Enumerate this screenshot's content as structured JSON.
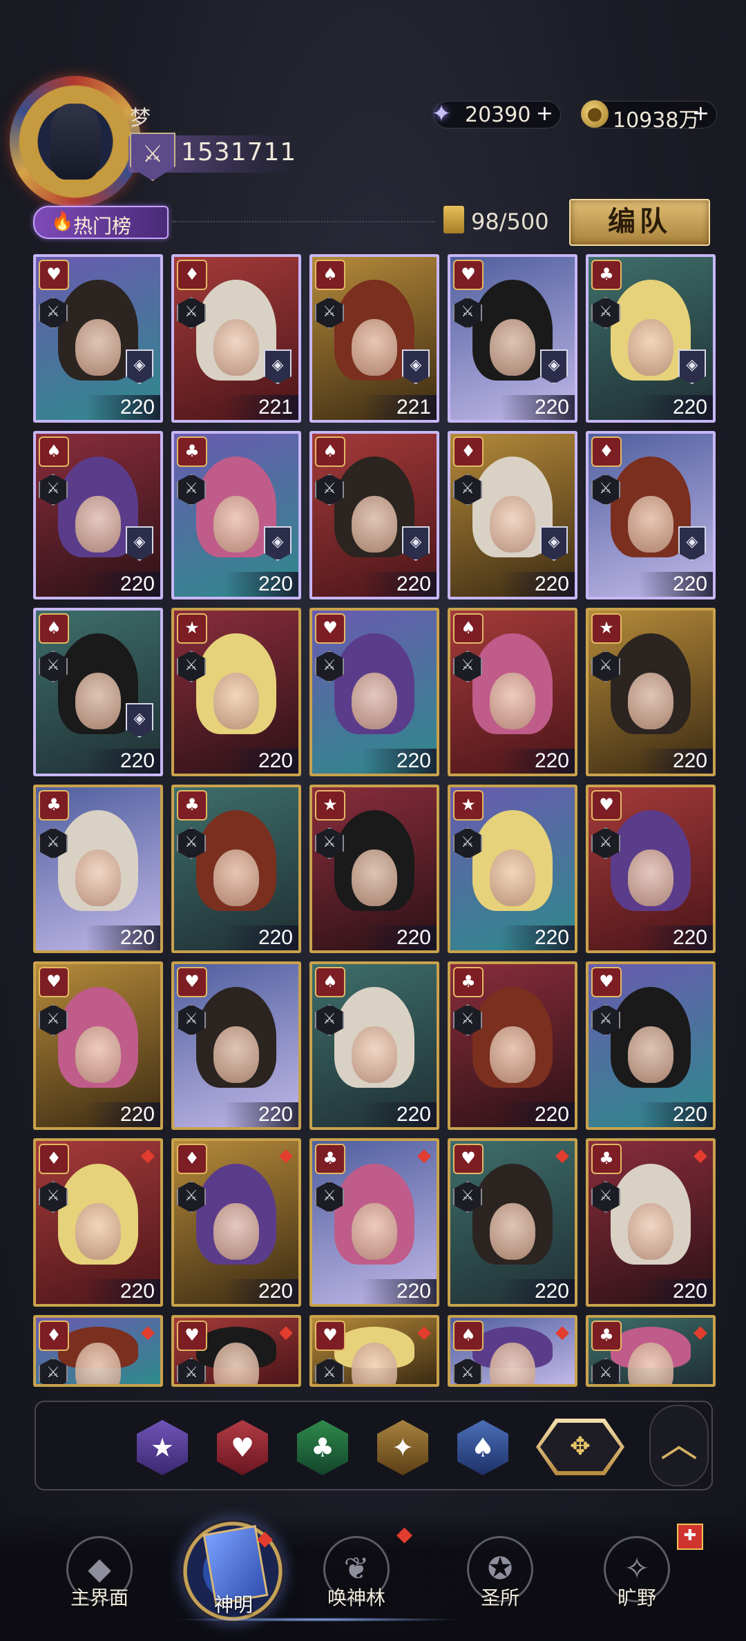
{
  "player": {
    "name": "梦",
    "power": "1531711"
  },
  "currencies": {
    "gem": {
      "value": "20390",
      "plus": "+"
    },
    "gold": {
      "value": "10938万",
      "plus": "+"
    }
  },
  "toolbar": {
    "hot_label": "热门榜",
    "count": "98/500",
    "team_button": "编队"
  },
  "cards": [
    {
      "suit": "♥",
      "level": "220"
    },
    {
      "suit": "♦",
      "level": "221"
    },
    {
      "suit": "♠",
      "level": "221"
    },
    {
      "suit": "♥",
      "level": "220"
    },
    {
      "suit": "♣",
      "level": "220"
    },
    {
      "suit": "♠",
      "level": "220"
    },
    {
      "suit": "♣",
      "level": "220"
    },
    {
      "suit": "♠",
      "level": "220"
    },
    {
      "suit": "♦",
      "level": "220"
    },
    {
      "suit": "♦",
      "level": "220"
    },
    {
      "suit": "♠",
      "level": "220"
    },
    {
      "suit": "★",
      "level": "220"
    },
    {
      "suit": "♥",
      "level": "220"
    },
    {
      "suit": "♠",
      "level": "220"
    },
    {
      "suit": "★",
      "level": "220"
    },
    {
      "suit": "♣",
      "level": "220"
    },
    {
      "suit": "♣",
      "level": "220"
    },
    {
      "suit": "★",
      "level": "220"
    },
    {
      "suit": "★",
      "level": "220"
    },
    {
      "suit": "♥",
      "level": "220"
    },
    {
      "suit": "♥",
      "level": "220"
    },
    {
      "suit": "♥",
      "level": "220"
    },
    {
      "suit": "♠",
      "level": "220"
    },
    {
      "suit": "♣",
      "level": "220"
    },
    {
      "suit": "♥",
      "level": "220"
    },
    {
      "suit": "♦",
      "level": "220"
    },
    {
      "suit": "♦",
      "level": "220"
    },
    {
      "suit": "♣",
      "level": "220"
    },
    {
      "suit": "♥",
      "level": "220"
    },
    {
      "suit": "♣",
      "level": "220"
    },
    {
      "suit": "♦",
      "level": ""
    },
    {
      "suit": "♥",
      "level": ""
    },
    {
      "suit": "♥",
      "level": ""
    },
    {
      "suit": "♠",
      "level": ""
    },
    {
      "suit": "♣",
      "level": ""
    }
  ],
  "filters": {
    "star_icon": "★",
    "heart_icon": "♥",
    "club_icon": "♣",
    "diamond_icon": "✦",
    "spade_icon": "♠",
    "all_icon": "✥",
    "collapse_icon": "︿"
  },
  "nav": {
    "items": [
      {
        "label": "主界面"
      },
      {
        "label": "神明"
      },
      {
        "label": "唤神林"
      },
      {
        "label": "圣所"
      },
      {
        "label": "旷野"
      }
    ]
  },
  "colors": {
    "accent_gold": "#c9a24c",
    "accent_purple": "#7e4bb8",
    "badge_red": "#e23d2f"
  }
}
